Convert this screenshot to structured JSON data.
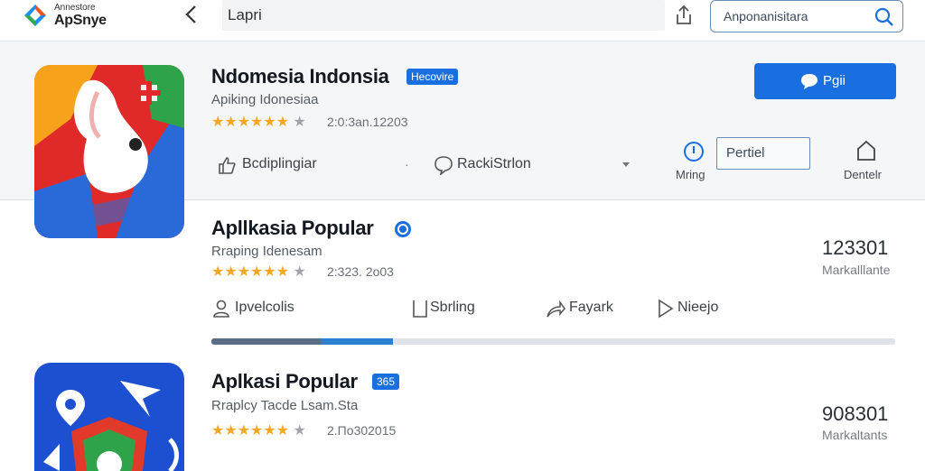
{
  "header": {
    "logo_small": "Annestore",
    "logo_big": "ApSnye",
    "address": "Lapri",
    "search_placeholder": "Anponanisitara"
  },
  "featured": {
    "title": "Ndomesia Indonsia",
    "badge": "Hecovire",
    "subtitle": "Apiking Idonesiaa",
    "stars_filled": 5,
    "stars_total": 6,
    "rating_text": "2:0:3an.12203",
    "open_button": "Pgii",
    "actions": [
      {
        "label": "Bcdiplingiar"
      },
      {
        "label": "RackiStrlon"
      },
      {
        "label": "Mring"
      },
      {
        "label": "Dentelr"
      }
    ],
    "portal_label": "Pertiel"
  },
  "apps": [
    {
      "title": "Apllkasia Popular",
      "subtitle": "Rraping Idenesam",
      "stars_filled": 5,
      "stars_total": 6,
      "rating_text": "2:323. 2o03",
      "count": "123301",
      "count_label": "Markalllante",
      "actions": [
        "Ipvelcolis",
        "Sbrling",
        "Fayark",
        "Nieejo"
      ],
      "progress": 0.265,
      "progress_secondary": 0.105
    },
    {
      "title": "Aplkasi Popular",
      "badge": "365",
      "subtitle": "Rraplcy Tacde Lsam.Sta",
      "stars_filled": 5,
      "stars_total": 6,
      "rating_text": "2.Πo302015",
      "count": "908301",
      "count_label": "Markaltants"
    }
  ],
  "colors": {
    "accent": "#1a6fe0",
    "star": "#f5a623",
    "progress_dark": "#5b6e87",
    "progress_blue": "#2d7fcf"
  },
  "icons": [
    "back-arrow-icon",
    "share-icon",
    "search-icon",
    "chat-bubble-icon",
    "thumbs-up-icon",
    "comment-icon",
    "info-icon",
    "bookmark-icon",
    "user-icon",
    "note-icon",
    "share-arrow-icon",
    "play-icon",
    "verified-badge-icon"
  ]
}
